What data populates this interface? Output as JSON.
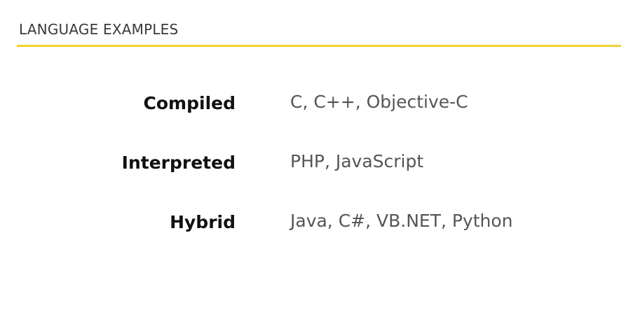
{
  "header": {
    "title": "LANGUAGE EXAMPLES"
  },
  "rows": [
    {
      "label": "Compiled",
      "value": "C, C++, Objective-C"
    },
    {
      "label": "Interpreted",
      "value": "PHP, JavaScript"
    },
    {
      "label": "Hybrid",
      "value": "Java, C#, VB.NET, Python"
    }
  ],
  "colors": {
    "accent_rule": "#f2d22e",
    "title_text": "#3a3a3a",
    "label_text": "#111111",
    "value_text": "#555555"
  }
}
